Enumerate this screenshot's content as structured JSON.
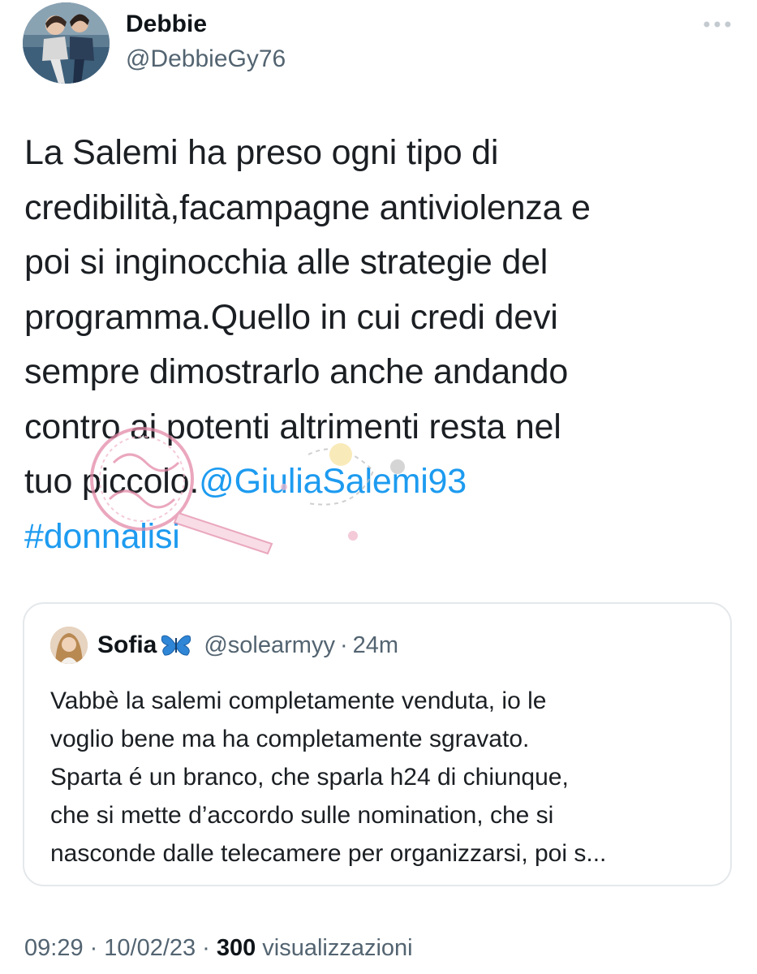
{
  "author": {
    "display_name": "Debbie",
    "handle": "@DebbieGy76",
    "avatar_icon": "profile-photo-icon"
  },
  "more_icon": "more-options-icon",
  "tweet": {
    "text": "La Salemi ha preso ogni tipo di\ncredibilità,facampagne antiviolenza e\npoi si inginocchia alle strategie del\nprogramma.Quello in cui credi devi\nsempre dimostrarlo anche andando\ncontro ai potenti altrimenti resta nel\ntuo piccolo.",
    "mention": "@GiuliaSalemi93",
    "hashtag": "#donnalisi"
  },
  "quoted_tweet": {
    "display_name": "Sofia",
    "name_icon": "butterfly-icon",
    "handle": "@solearmyy",
    "separator": "·",
    "time": "24m",
    "text": "Vabbè la salemi completamente venduta, io le\nvoglio bene ma ha completamente sgravato.\nSparta é un branco, che sparla h24 di chiunque,\nche si mette d’accordo sulle nomination, che si\nnasconde dalle telecamere per organizzarsi, poi s..."
  },
  "footer": {
    "time": "09:29",
    "separator": "·",
    "date": "10/02/23",
    "views_count": "300",
    "views_label": "visualizzazioni"
  },
  "colors": {
    "link": "#1d9bf0",
    "text": "#0f1419",
    "secondary": "#536471",
    "border": "#e4e8eb",
    "watermark_pink": "#e38aa8"
  }
}
